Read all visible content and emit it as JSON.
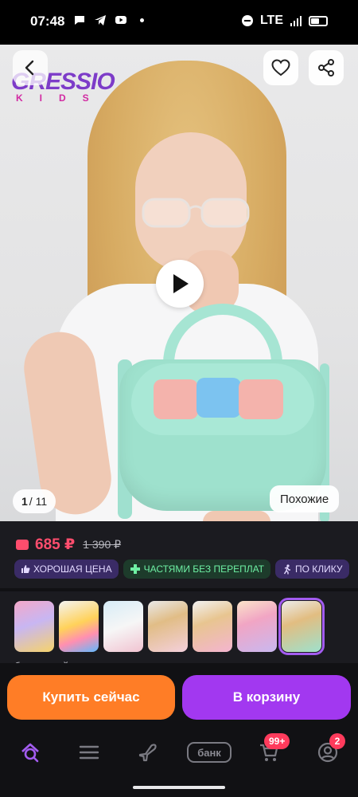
{
  "status_bar": {
    "time": "07:48",
    "network": "LTE"
  },
  "product": {
    "brand_logo": {
      "main": "GRESSIO",
      "sub": "KIDS"
    },
    "image_counter": {
      "current": "1",
      "total": "/ 11"
    },
    "similar_label": "Похожие",
    "price": "685 ₽",
    "old_price": "1 390 ₽",
    "badges": [
      "ХОРОШАЯ ЦЕНА",
      "ЧАСТЯМИ БЕЗ ПЕРЕПЛАТ",
      "ПО КЛИКУ"
    ],
    "selected_color": "бирюзовый",
    "thumbnails": [
      "thumb-1",
      "thumb-2",
      "thumb-3",
      "thumb-4",
      "thumb-5",
      "thumb-6",
      "thumb-7"
    ]
  },
  "actions": {
    "buy_now": "Купить сейчас",
    "add_to_cart": "В корзину"
  },
  "tabbar": {
    "bank_label": "банк",
    "cart_badge": "99+",
    "profile_badge": "2"
  },
  "colors": {
    "price": "#ff4d6d",
    "buy": "#ff7d26",
    "cart": "#a238f0",
    "accent": "#a35cf0"
  },
  "icons": [
    "back-arrow-icon",
    "heart-icon",
    "share-icon",
    "play-icon",
    "wallet-icon",
    "thumb-up-icon",
    "plus-cross-icon",
    "running-icon",
    "home-search-icon",
    "menu-icon",
    "plane-icon",
    "cart-icon",
    "profile-icon"
  ]
}
